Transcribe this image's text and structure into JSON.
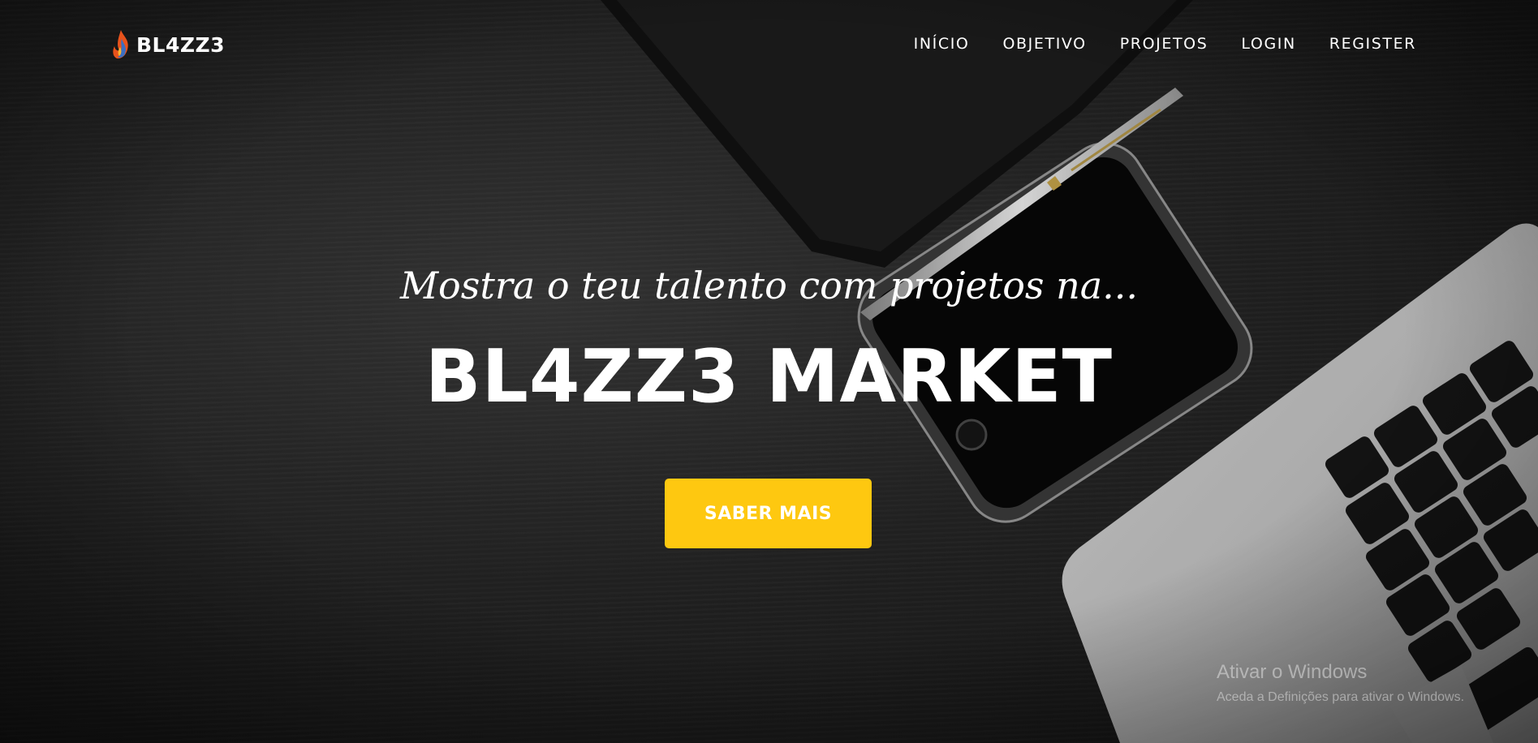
{
  "brand": {
    "name": "BL4ZZ3",
    "icon": "flame-logo-icon"
  },
  "nav": {
    "items": [
      {
        "label": "INÍCIO"
      },
      {
        "label": "OBJETIVO"
      },
      {
        "label": "PROJETOS"
      },
      {
        "label": "LOGIN"
      },
      {
        "label": "REGISTER"
      }
    ]
  },
  "hero": {
    "subheading": "Mostra o teu talento com projetos na...",
    "heading": "BL4ZZ3 MARKET",
    "cta_label": "SABER MAIS",
    "background_description_icons": [
      "notebook-image",
      "pen-image",
      "smartphone-image",
      "laptop-image"
    ]
  },
  "windows_activation": {
    "title": "Ativar o Windows",
    "subtitle": "Aceda a Definições para ativar o Windows."
  },
  "colors": {
    "accent": "#fec810",
    "text": "#ffffff",
    "background": "#262626"
  }
}
